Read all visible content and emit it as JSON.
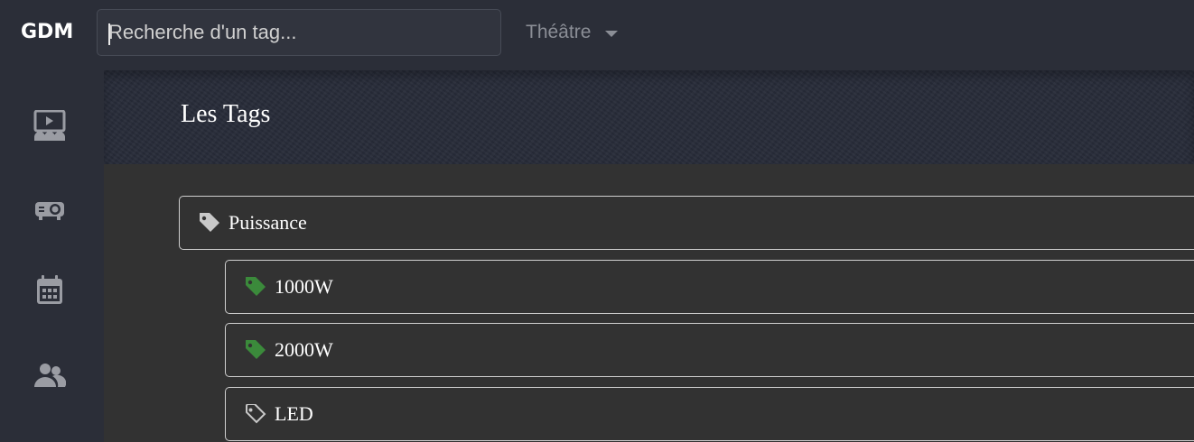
{
  "app": {
    "logo": "GDM"
  },
  "search": {
    "placeholder": "Recherche d'un tag..."
  },
  "venue_select": {
    "selected": "Théâtre"
  },
  "sidebar": {
    "items": [
      {
        "icon": "theater-screen-icon"
      },
      {
        "icon": "projector-icon"
      },
      {
        "icon": "calendar-icon"
      },
      {
        "icon": "users-icon"
      }
    ]
  },
  "page": {
    "title": "Les Tags"
  },
  "tags": [
    {
      "label": "Puissance",
      "icon": "tag-icon",
      "level": 0,
      "color": "#c8c8c8"
    },
    {
      "label": "1000W",
      "icon": "tag-icon",
      "level": 1,
      "color": "#3b8a3b"
    },
    {
      "label": "2000W",
      "icon": "tag-icon",
      "level": 1,
      "color": "#3b8a3b"
    },
    {
      "label": "LED",
      "icon": "tag-outline-icon",
      "level": 1,
      "color": "#c8c8c8"
    }
  ]
}
